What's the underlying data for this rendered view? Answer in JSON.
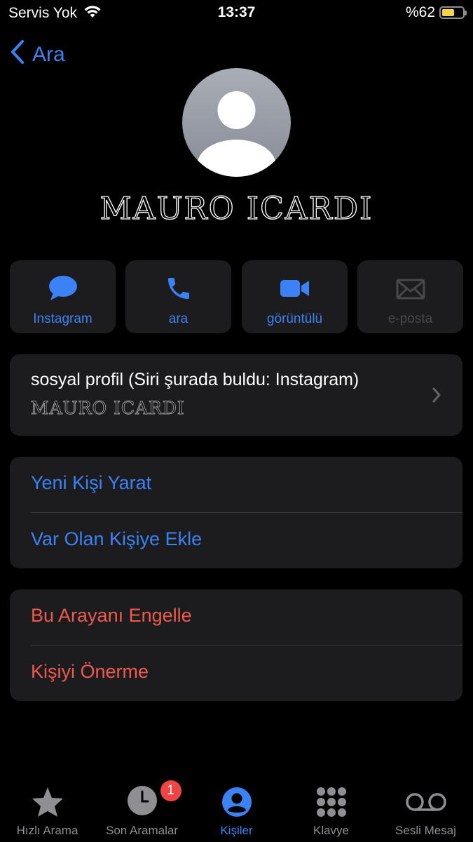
{
  "status_bar": {
    "carrier": "Servis Yok",
    "time": "13:37",
    "battery_text": "%62",
    "battery_level": 0.62,
    "battery_color": "#f5d547"
  },
  "nav": {
    "back_label": "Ara",
    "back_icon": "chevron-left-icon"
  },
  "contact": {
    "name": "MAURO ICARDI",
    "avatar_icon": "person-silhouette-icon"
  },
  "actions": [
    {
      "label": "Instagram",
      "icon": "message-bubble-icon",
      "enabled": true
    },
    {
      "label": "ara",
      "icon": "phone-icon",
      "enabled": true
    },
    {
      "label": "görüntülü",
      "icon": "video-camera-icon",
      "enabled": true
    },
    {
      "label": "e-posta",
      "icon": "envelope-icon",
      "enabled": false
    }
  ],
  "social_profile": {
    "title": "sosyal profil (Siri şurada buldu: Instagram)",
    "value": "MAURO ICARDI",
    "chevron_icon": "chevron-right-icon"
  },
  "add_contact": {
    "create_new": "Yeni Kişi Yarat",
    "add_existing": "Var Olan Kişiye Ekle"
  },
  "caller_actions": {
    "block": "Bu Arayanı Engelle",
    "do_not_suggest": "Kişiyi Önerme"
  },
  "tabs": [
    {
      "label": "Hızlı Arama",
      "icon": "star-icon",
      "active": false
    },
    {
      "label": "Son Aramalar",
      "icon": "clock-icon",
      "active": false,
      "badge": "1"
    },
    {
      "label": "Kişiler",
      "icon": "person-circle-icon",
      "active": true
    },
    {
      "label": "Klavye",
      "icon": "keypad-icon",
      "active": false
    },
    {
      "label": "Sesli Mesaj",
      "icon": "voicemail-icon",
      "active": false
    }
  ],
  "colors": {
    "accent": "#3b82f6",
    "destructive": "#ef5a4c",
    "card_background": "#1c1c1e",
    "badge": "#ef4444"
  }
}
